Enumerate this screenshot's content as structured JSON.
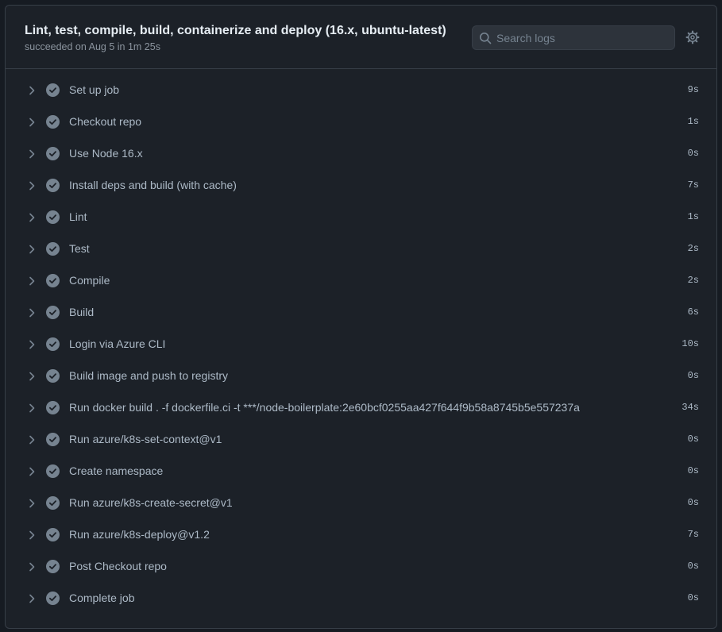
{
  "header": {
    "title": "Lint, test, compile, build, containerize and deploy (16.x, ubuntu-latest)",
    "subtitle": "succeeded on Aug 5 in 1m 25s"
  },
  "search": {
    "placeholder": "Search logs",
    "value": ""
  },
  "icons": {
    "search": "search-icon",
    "settings": "gear-icon",
    "expand": "chevron-right-icon",
    "status": "check-circle-icon"
  },
  "colors": {
    "background": "#1c2128",
    "border": "#373e47",
    "status_success": "#768390"
  },
  "steps": [
    {
      "label": "Set up job",
      "duration": "9s",
      "status": "success"
    },
    {
      "label": "Checkout repo",
      "duration": "1s",
      "status": "success"
    },
    {
      "label": "Use Node 16.x",
      "duration": "0s",
      "status": "success"
    },
    {
      "label": "Install deps and build (with cache)",
      "duration": "7s",
      "status": "success"
    },
    {
      "label": "Lint",
      "duration": "1s",
      "status": "success"
    },
    {
      "label": "Test",
      "duration": "2s",
      "status": "success"
    },
    {
      "label": "Compile",
      "duration": "2s",
      "status": "success"
    },
    {
      "label": "Build",
      "duration": "6s",
      "status": "success"
    },
    {
      "label": "Login via Azure CLI",
      "duration": "10s",
      "status": "success"
    },
    {
      "label": "Build image and push to registry",
      "duration": "0s",
      "status": "success"
    },
    {
      "label": "Run docker build . -f dockerfile.ci -t ***/node-boilerplate:2e60bcf0255aa427f644f9b58a8745b5e557237a",
      "duration": "34s",
      "status": "success"
    },
    {
      "label": "Run azure/k8s-set-context@v1",
      "duration": "0s",
      "status": "success"
    },
    {
      "label": "Create namespace",
      "duration": "0s",
      "status": "success"
    },
    {
      "label": "Run azure/k8s-create-secret@v1",
      "duration": "0s",
      "status": "success"
    },
    {
      "label": "Run azure/k8s-deploy@v1.2",
      "duration": "7s",
      "status": "success"
    },
    {
      "label": "Post Checkout repo",
      "duration": "0s",
      "status": "success"
    },
    {
      "label": "Complete job",
      "duration": "0s",
      "status": "success"
    }
  ]
}
